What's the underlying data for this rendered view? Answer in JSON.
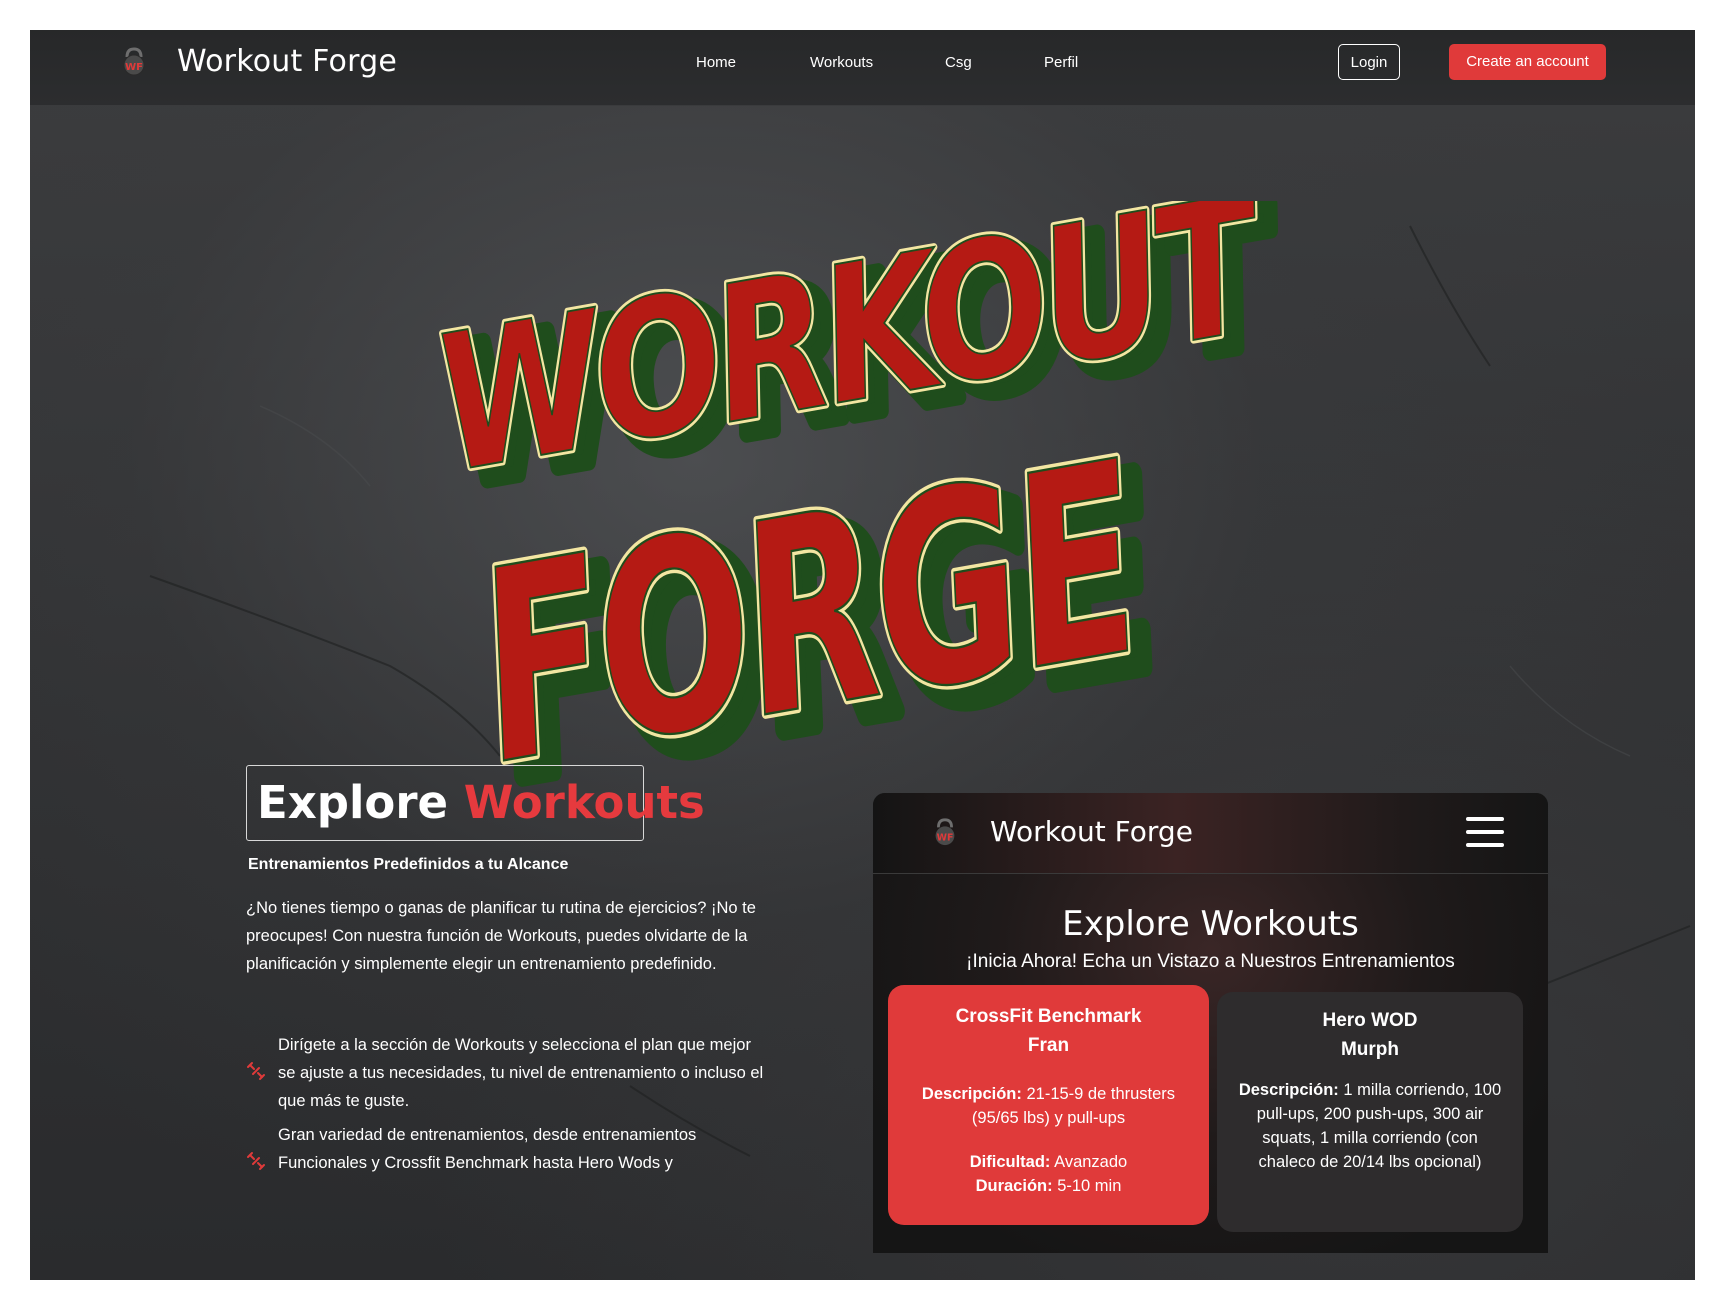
{
  "nav": {
    "brand": "Workout Forge",
    "links": [
      "Home",
      "Workouts",
      "Csg",
      "Perfil"
    ],
    "login": "Login",
    "create": "Create an account"
  },
  "hero": {
    "logo_line1": "WORKOUT",
    "logo_line2": "FORGE"
  },
  "explore": {
    "title_white": "Explore",
    "title_red": "Workouts",
    "subtitle": "Entrenamientos Predefinidos a tu Alcance",
    "paragraph": "¿No tienes tiempo o ganas de planificar tu rutina de ejercicios? ¡No te preocupes! Con nuestra función de Workouts, puedes olvidarte de la planificación y simplemente elegir un entrenamiento predefinido.",
    "bullets": [
      "Dirígete a la sección de Workouts y selecciona el plan que mejor se ajuste a tus necesidades, tu nivel de entrenamiento o incluso el que más te guste.",
      "Gran variedad de entrenamientos, desde entrenamientos Funcionales y Crossfit Benchmark hasta Hero Wods y"
    ]
  },
  "phone": {
    "brand": "Workout Forge",
    "title": "Explore Workouts",
    "subtitle": "¡Inicia Ahora! Echa un Vistazo a Nuestros Entrenamientos",
    "cards": [
      {
        "line1": "CrossFit Benchmark",
        "line2": "Fran",
        "desc_label": "Descripción:",
        "desc": "21-15-9 de thrusters (95/65 lbs) y pull-ups",
        "diff_label": "Dificultad:",
        "diff": "Avanzado",
        "dur_label": "Duración:",
        "dur": "5-10 min"
      },
      {
        "line1": "Hero WOD",
        "line2": "Murph",
        "desc_label": "Descripción:",
        "desc": "1 milla corriendo, 100 pull-ups, 200 push-ups, 300 air squats, 1 milla corriendo (con chaleco de 20/14 lbs opcional)"
      }
    ]
  },
  "colors": {
    "accent": "#e03a3a",
    "logo_red": "#b51a14",
    "logo_green": "#1f4d1c",
    "logo_cream": "#f3e6a2"
  }
}
